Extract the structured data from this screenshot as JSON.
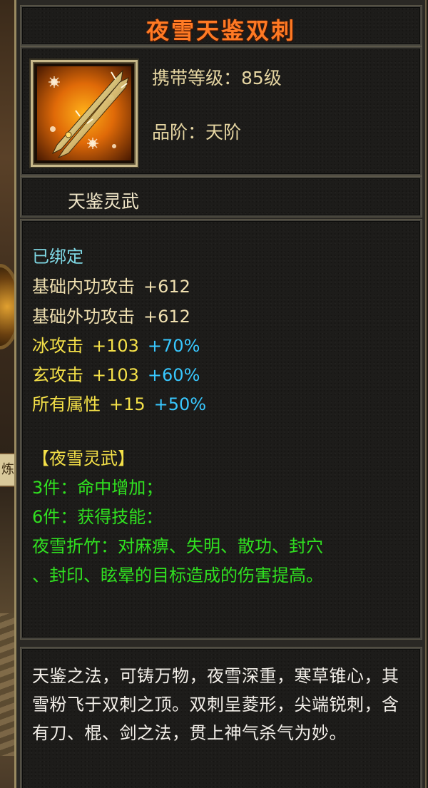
{
  "item": {
    "name": "夜雪天鉴双刺",
    "icon": "twin-daggers-icon",
    "level_requirement": "携带等级：85级",
    "grade": "品阶：天阶",
    "set_name": "天鉴灵武"
  },
  "stats": {
    "bound": "已绑定",
    "base_internal": {
      "label": "基础内功攻击",
      "value": "+612"
    },
    "base_external": {
      "label": "基础外功攻击",
      "value": "+612"
    },
    "ice_attack": {
      "label": "冰攻击",
      "value": "+103",
      "bonus": "+70%"
    },
    "xuan_attack": {
      "label": "玄攻击",
      "value": "+103",
      "bonus": "+60%"
    },
    "all_attributes": {
      "label": "所有属性",
      "value": "+15",
      "bonus": "+50%"
    }
  },
  "set_bonus": {
    "title": "【夜雪灵武】",
    "three_piece": "3件：命中增加；",
    "six_piece": "6件：获得技能：",
    "skill_line1": "夜雪折竹：对麻痹、失明、散功、封穴",
    "skill_line2": "、封印、眩晕的目标造成的伤害提高。"
  },
  "description": "天鉴之法，可铸万物，夜雪深重，寒草锥心，其雪粉飞于双刺之顶。双刺呈菱形，尖端锐刺，含有刀、棍、剑之法，贯上神气杀气为妙。",
  "background": {
    "side_tab_label": "炼"
  },
  "colors": {
    "title": "#ff7a24",
    "bound": "#7fd8e4",
    "base_stat": "#f0e0b0",
    "elemental_stat": "#f4e048",
    "percent_bonus": "#38c8ff",
    "set_bonus": "#30e020",
    "description": "#f4f0ea"
  }
}
